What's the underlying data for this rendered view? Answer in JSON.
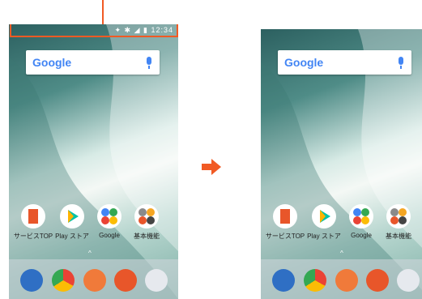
{
  "left_screen": {
    "status_time": "12:34",
    "search_logo": "Google",
    "apps": [
      "サービスTOP",
      "Play ストア",
      "Google",
      "基本機能"
    ]
  },
  "right_screen": {
    "search_logo": "Google",
    "apps": [
      "サービスTOP",
      "Play ストア",
      "Google",
      "基本機能"
    ]
  },
  "dock_icons": [
    "phone-icon",
    "chrome-icon",
    "sms-icon",
    "email-icon",
    "camera-icon"
  ],
  "colors": {
    "highlight": "#f15a24",
    "google_blue": "#4285f4"
  }
}
